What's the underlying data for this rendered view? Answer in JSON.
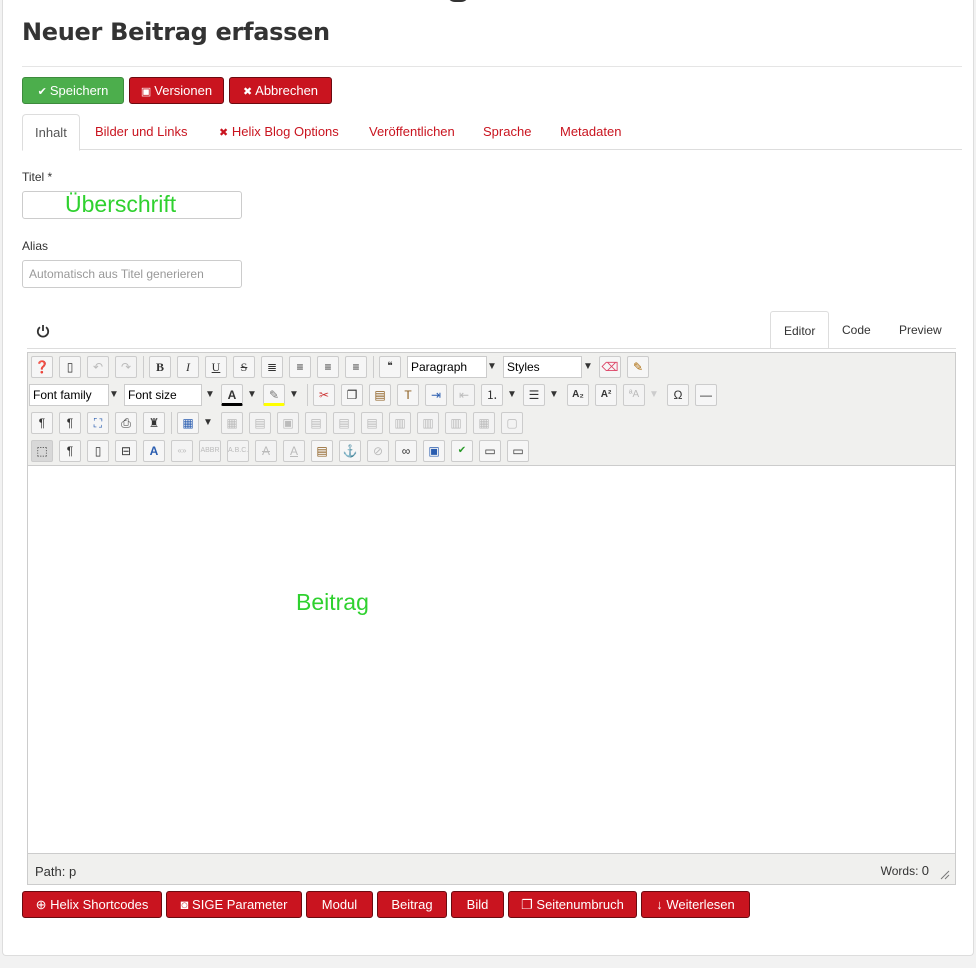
{
  "page": {
    "title": "Neuer Beitrag erfassen"
  },
  "actions": {
    "save": "Speichern",
    "versions": "Versionen",
    "cancel": "Abbrechen"
  },
  "tabs": [
    "Inhalt",
    "Bilder und Links",
    "Helix Blog Options",
    "Veröffentlichen",
    "Sprache",
    "Metadaten"
  ],
  "form": {
    "title_label": "Titel *",
    "title_value": "Überschrift",
    "alias_label": "Alias",
    "alias_placeholder": "Automatisch aus Titel generieren"
  },
  "editor": {
    "tabs": [
      "Editor",
      "Code",
      "Preview"
    ],
    "format_select": "Paragraph",
    "styles_select": "Styles",
    "font_family": "Font family",
    "font_size": "Font size",
    "content": "Beitrag",
    "path_label": "Path: p",
    "words_label": "Words:",
    "words_count": "0"
  },
  "buttons": [
    "Helix Shortcodes",
    "SIGE Parameter",
    "Modul",
    "Beitrag",
    "Bild",
    "Seitenumbruch",
    "Weiterlesen"
  ],
  "colors": {
    "green": "#4cae4c",
    "red": "#c9141f",
    "placeholder_text": "#2fd12f"
  }
}
